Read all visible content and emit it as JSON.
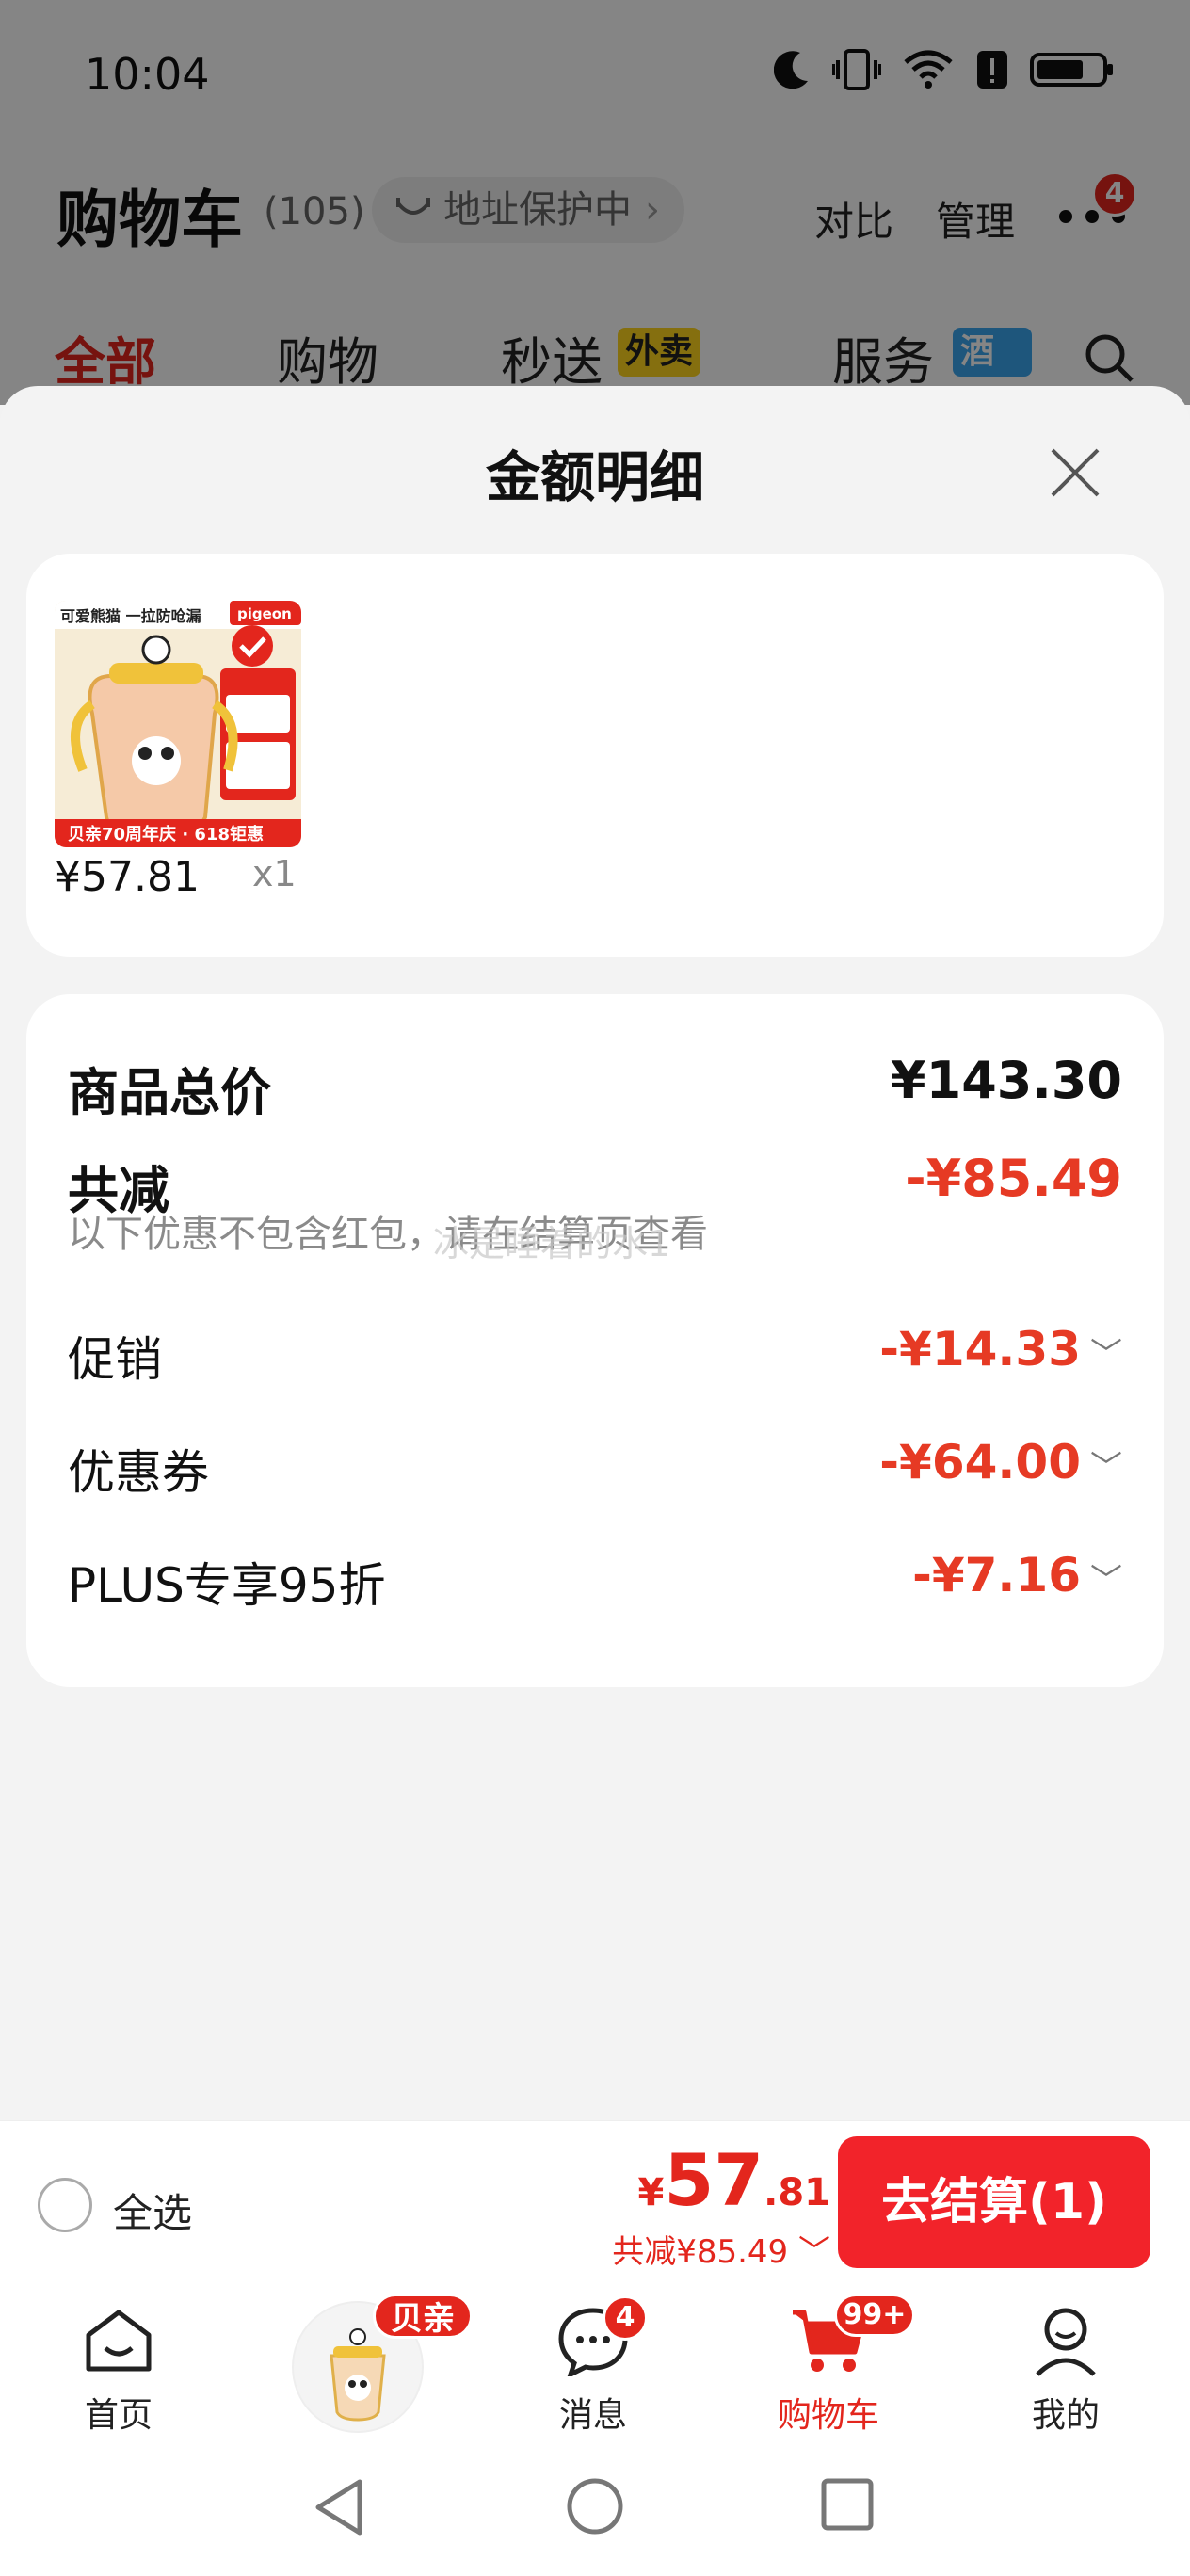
{
  "status_bar": {
    "time": "10:04"
  },
  "cart_header": {
    "title": "购物车",
    "count": "(105)",
    "address_label": "地址保护中",
    "compare_label": "对比",
    "manage_label": "管理",
    "more_badge": "4"
  },
  "tabs": [
    {
      "label": "全部",
      "active": true
    },
    {
      "label": "购物",
      "active": false
    },
    {
      "label": "秒送",
      "tag": "外卖",
      "active": false
    },
    {
      "label": "服务",
      "tag": "酒旅",
      "active": false
    }
  ],
  "sheet": {
    "title": "金额明细",
    "product": {
      "price": "¥57.81",
      "qty": "x1",
      "thumb": {
        "headline": "可爱熊猫 一拉防呛漏",
        "brand": "pigeon",
        "promo": "贝亲70周年庆 · 618钜惠"
      }
    },
    "details": {
      "subtotal_label": "商品总价",
      "subtotal_value": "¥143.30",
      "discount_label": "共减",
      "discount_value": "-¥85.49",
      "note": "以下优惠不包含红包，请在结算页查看",
      "items": [
        {
          "label": "促销",
          "value": "-¥14.33"
        },
        {
          "label": "优惠券",
          "value": "-¥64.00"
        },
        {
          "label": "PLUS专享95折",
          "value": "-¥7.16"
        }
      ]
    },
    "watermark": "冰是睡着的水1"
  },
  "checkout": {
    "select_all": "全选",
    "currency": "¥",
    "total_int": "57",
    "total_dec": ".81",
    "saved": "共减¥85.49",
    "button": "去结算(1)"
  },
  "tabbar": {
    "home": "首页",
    "promo_tag": "贝亲",
    "messages": "消息",
    "messages_badge": "4",
    "cart": "购物车",
    "cart_badge": "99+",
    "mine": "我的"
  },
  "colors": {
    "accent": "#e3261d",
    "discount_red": "#e63a24",
    "checkout_button": "#f2232a"
  }
}
